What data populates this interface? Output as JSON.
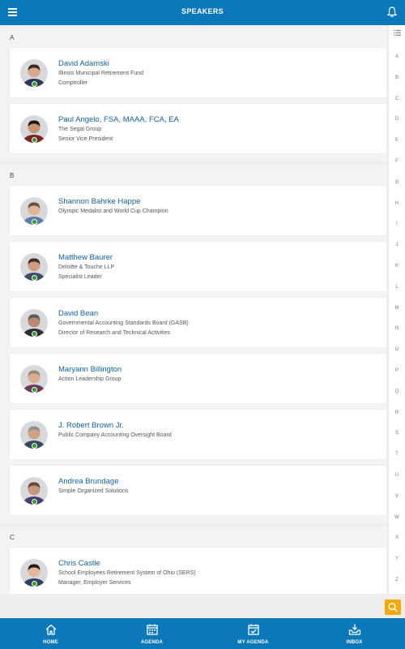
{
  "header": {
    "title": "SPEAKERS"
  },
  "sections": [
    {
      "letter": "A",
      "speakers": [
        {
          "name": "David Adamski",
          "lines": [
            "Illinois Municipal Retirement Fund",
            "Comptroller"
          ],
          "online": true
        },
        {
          "name": "Paul Angelo, FSA, MAAA, FCA, EA",
          "lines": [
            "The Segal Group",
            "Senior Vice President"
          ],
          "online": true
        }
      ]
    },
    {
      "letter": "B",
      "speakers": [
        {
          "name": "Shannon Bahrke Happe",
          "lines": [
            "Olympic Medalist and World Cup Champion"
          ],
          "online": true
        },
        {
          "name": "Matthew Baurer",
          "lines": [
            "Deloitte & Touche LLP",
            "Specialist Leader"
          ],
          "online": true
        },
        {
          "name": "David Bean",
          "lines": [
            "Governmental Accounting Standards Board (GASB)",
            "Director of Research and Technical Activities"
          ],
          "online": true
        },
        {
          "name": "Maryann Billington",
          "lines": [
            "Action Leadership Group"
          ],
          "online": true
        },
        {
          "name": "J. Robert Brown Jr.",
          "lines": [
            "Public Company Accounting Oversight Board"
          ],
          "online": true
        },
        {
          "name": "Andrea Brundage",
          "lines": [
            "Simple Organized Solutions"
          ],
          "online": true
        }
      ]
    },
    {
      "letter": "C",
      "speakers": [
        {
          "name": "Chris Castle",
          "lines": [
            "School Employees Retirement System of Ohio (SERS)",
            "Manager, Employer Services"
          ],
          "online": true
        }
      ]
    }
  ],
  "alphabet": [
    "A",
    "B",
    "C",
    "D",
    "E",
    "F",
    "G",
    "H",
    "I",
    "J",
    "K",
    "L",
    "M",
    "N",
    "O",
    "P",
    "Q",
    "R",
    "S",
    "T",
    "U",
    "V",
    "W",
    "X",
    "Y",
    "Z"
  ],
  "bottom_nav": [
    {
      "label": "HOME",
      "icon": "home-icon"
    },
    {
      "label": "AGENDA",
      "icon": "calendar-icon"
    },
    {
      "label": "MY AGENDA",
      "icon": "calendar-check-icon"
    },
    {
      "label": "INBOX",
      "icon": "inbox-icon"
    }
  ],
  "colors": {
    "brand": "#0b78b9",
    "name_link": "#12609e",
    "online": "#2aa02a",
    "search": "#f2a900"
  }
}
